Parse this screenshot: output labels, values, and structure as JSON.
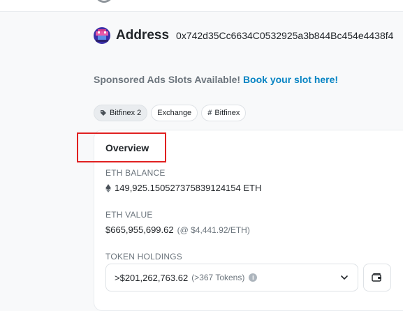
{
  "address": {
    "title": "Address",
    "hash": "0x742d35Cc6634C0532925a3b844Bc454e4438f4"
  },
  "ads": {
    "text": "Sponsored Ads Slots Available!",
    "link": "Book your slot here!"
  },
  "tags": [
    {
      "label": "Bitfinex 2",
      "icon": "tag-icon"
    },
    {
      "label": "Exchange"
    },
    {
      "label": "Bitfinex",
      "icon": "hash-icon"
    }
  ],
  "overview": {
    "title": "Overview",
    "eth_balance_label": "ETH BALANCE",
    "eth_balance": "149,925.150527375839124154 ETH",
    "eth_value_label": "ETH VALUE",
    "eth_value": "$665,955,699.62",
    "eth_price": "(@ $4,441.92/ETH)",
    "token_holdings_label": "TOKEN HOLDINGS",
    "token_amount": ">$201,262,763.62",
    "token_count": "(>367 Tokens)"
  },
  "colors": {
    "link": "#0784c3",
    "highlight": "#e02020",
    "muted": "#6c757d"
  }
}
